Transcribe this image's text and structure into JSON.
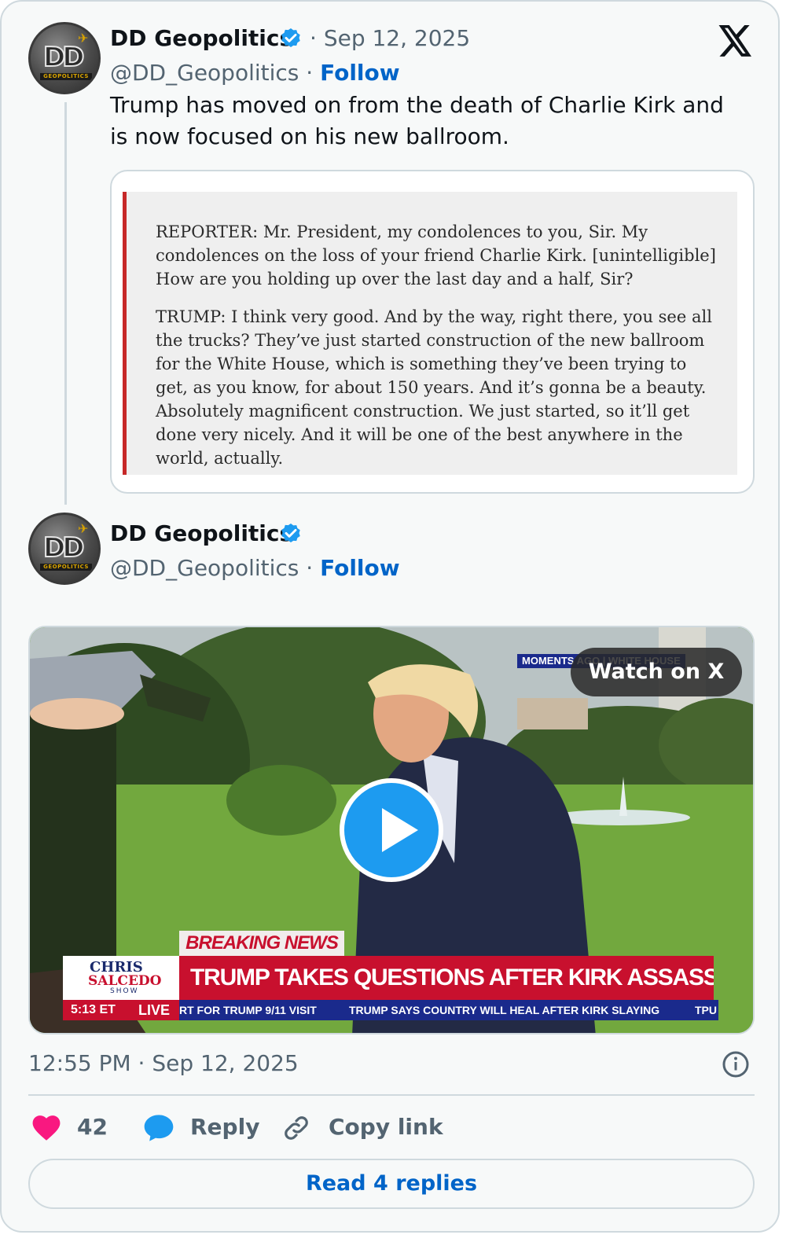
{
  "tweet1": {
    "author_name": "DD Geopolitics",
    "handle": "@DD_Geopolitics",
    "date": "Sep 12, 2025",
    "follow_label": "Follow",
    "text": "Trump has moved on from the death of Charlie Kirk and is now focused on his new ballroom.",
    "quote": {
      "paragraph1": "REPORTER: Mr. President, my condolences to you, Sir. My condolences on the loss of your friend Charlie Kirk. [unintelligible] How are you holding up over the last day and a half, Sir?",
      "paragraph2": "TRUMP: I think very good. And by the way, right there, you see all the trucks? They’ve just started construction of the new ballroom for the White House, which is something they’ve been trying to get, as you know, for about 150 years. And it’s gonna be a beauty. Absolutely magnificent construction. We just started, so it’ll get done very nicely. And it will be one of the best anywhere in the world, actually."
    }
  },
  "tweet2": {
    "author_name": "DD Geopolitics",
    "handle": "@DD_Geopolitics",
    "follow_label": "Follow",
    "video": {
      "watch_label": "Watch on X",
      "moments_text": "MOMENTS AGO | WHITE HOUSE",
      "breaking_label": "BREAKING NEWS",
      "headline": "TRUMP TAKES QUESTIONS AFTER KIRK ASSASSINATION",
      "show_logo_line1": "CHRIS",
      "show_logo_line2": "SALCEDO",
      "show_logo_line3": "SHOW",
      "time": "5:13 ET",
      "live": "LIVE",
      "ticker1": "RT FOR TRUMP 9/11 VISIT",
      "ticker2": "TRUMP SAYS COUNTRY WILL HEAL AFTER KIRK SLAYING",
      "ticker3": "TPU"
    },
    "timestamp": "12:55 PM · Sep 12, 2025",
    "like_count": "42",
    "reply_label": "Reply",
    "copy_link_label": "Copy link",
    "read_replies_label": "Read 4 replies"
  },
  "colors": {
    "accent_blue": "#1d9bf0",
    "follow_blue": "#0064c8",
    "like_pink": "#f91880",
    "muted_text": "#536471",
    "news_red": "#c8102e"
  },
  "icons": [
    "verified-badge-icon",
    "x-logo-icon",
    "play-icon",
    "info-icon",
    "heart-icon",
    "reply-bubble-icon",
    "link-icon"
  ]
}
